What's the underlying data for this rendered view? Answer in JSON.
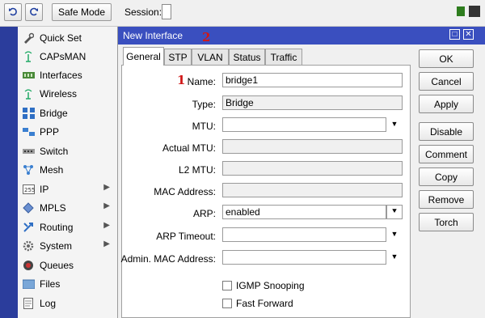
{
  "toolbar": {
    "undo_icon": "undo-icon",
    "redo_icon": "redo-icon",
    "safe_mode_label": "Safe Mode",
    "session_label": "Session:"
  },
  "menu": {
    "items": [
      {
        "label": "Quick Set",
        "icon": "quickset-icon",
        "submenu": false
      },
      {
        "label": "CAPsMAN",
        "icon": "capsman-icon",
        "submenu": false
      },
      {
        "label": "Interfaces",
        "icon": "interfaces-icon",
        "submenu": false
      },
      {
        "label": "Wireless",
        "icon": "wireless-icon",
        "submenu": false
      },
      {
        "label": "Bridge",
        "icon": "bridge-icon",
        "submenu": false
      },
      {
        "label": "PPP",
        "icon": "ppp-icon",
        "submenu": false
      },
      {
        "label": "Switch",
        "icon": "switch-icon",
        "submenu": false
      },
      {
        "label": "Mesh",
        "icon": "mesh-icon",
        "submenu": false
      },
      {
        "label": "IP",
        "icon": "ip-icon",
        "submenu": true
      },
      {
        "label": "MPLS",
        "icon": "mpls-icon",
        "submenu": true
      },
      {
        "label": "Routing",
        "icon": "routing-icon",
        "submenu": true
      },
      {
        "label": "System",
        "icon": "system-icon",
        "submenu": true
      },
      {
        "label": "Queues",
        "icon": "queues-icon",
        "submenu": false
      },
      {
        "label": "Files",
        "icon": "files-icon",
        "submenu": false
      },
      {
        "label": "Log",
        "icon": "log-icon",
        "submenu": false
      }
    ]
  },
  "dialog": {
    "title": "New Interface",
    "tabs": [
      "General",
      "STP",
      "VLAN",
      "Status",
      "Traffic"
    ],
    "active_tab": "General",
    "fields": {
      "name_label": "Name:",
      "name_value": "bridge1",
      "type_label": "Type:",
      "type_value": "Bridge",
      "mtu_label": "MTU:",
      "mtu_value": "",
      "actual_mtu_label": "Actual MTU:",
      "actual_mtu_value": "",
      "l2_mtu_label": "L2 MTU:",
      "l2_mtu_value": "",
      "mac_label": "MAC Address:",
      "mac_value": "",
      "arp_label": "ARP:",
      "arp_value": "enabled",
      "arp_timeout_label": "ARP Timeout:",
      "arp_timeout_value": "",
      "admin_mac_label": "Admin. MAC Address:",
      "admin_mac_value": ""
    },
    "checkboxes": [
      {
        "label": "IGMP Snooping",
        "checked": false
      },
      {
        "label": "Fast Forward",
        "checked": false
      }
    ],
    "buttons": {
      "ok": "OK",
      "cancel": "Cancel",
      "apply": "Apply",
      "disable": "Disable",
      "comment": "Comment",
      "copy": "Copy",
      "remove": "Remove",
      "torch": "Torch"
    }
  },
  "annotations": {
    "one": "1",
    "two": "2"
  },
  "colors": {
    "titlebar": "#3a4fbf",
    "left_strip": "#2b3d9c",
    "annotation": "#d01818",
    "status_green": "#2e7d1e"
  }
}
